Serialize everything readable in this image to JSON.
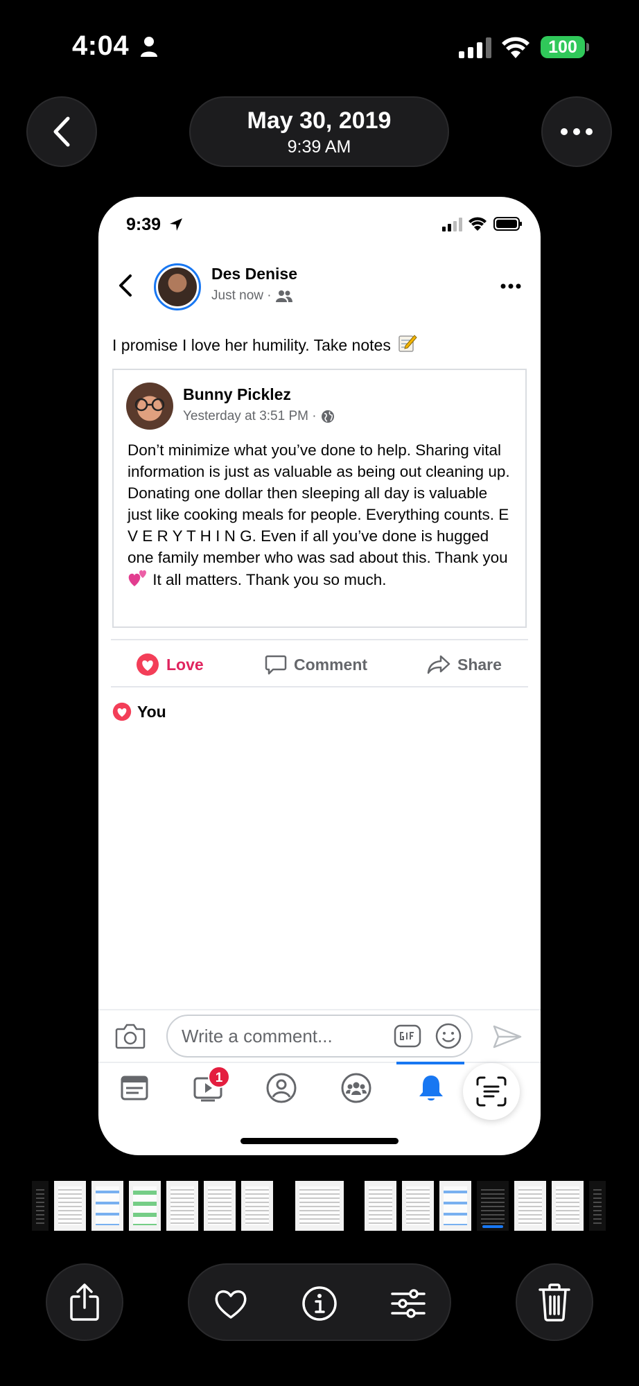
{
  "status_bar": {
    "time": "4:04",
    "battery": "100"
  },
  "header": {
    "date": "May 30, 2019",
    "time": "9:39 AM"
  },
  "screenshot": {
    "status_time": "9:39",
    "post": {
      "author": "Des Denise",
      "meta": "Just now ·",
      "text": "I promise I love her humility. Take notes",
      "shared": {
        "author": "Bunny Picklez",
        "meta": "Yesterday at 3:51 PM ·",
        "body_part1": "Don’t minimize what you’ve done to help. Sharing vital information is just as valuable as being out cleaning up. Donating one dollar then sleeping all day is valuable just like cooking meals for people. Everything counts. E V E R Y T H I N G. Even if all you’ve done is hugged one family member who was sad about this. Thank you",
        "body_part2": " It all matters. Thank you so much."
      },
      "actions": {
        "love": "Love",
        "comment": "Comment",
        "share": "Share"
      },
      "reactions": "You"
    },
    "comment_placeholder": "Write a comment...",
    "watch_badge": "1"
  },
  "colors": {
    "facebook_blue": "#1877f2",
    "love_red": "#e0245e",
    "battery_green": "#30c85a"
  }
}
